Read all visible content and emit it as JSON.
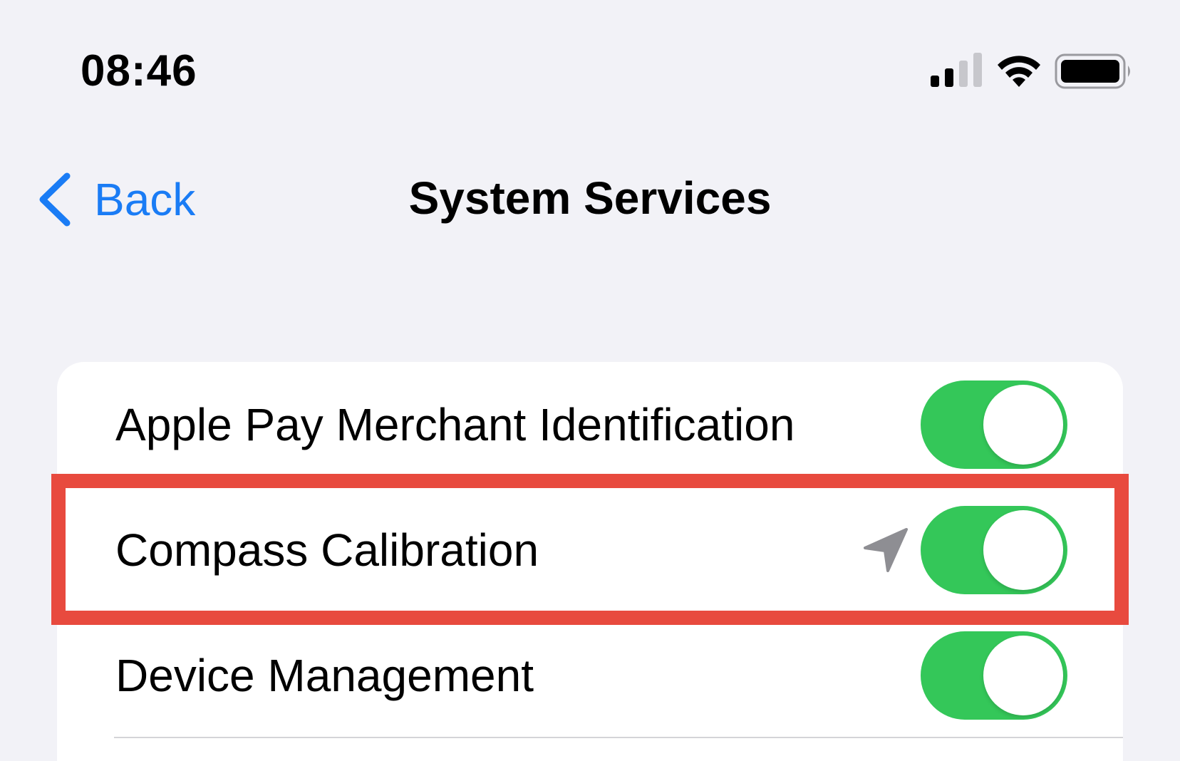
{
  "status_bar": {
    "time": "08:46",
    "icons": [
      "cellular-signal-icon",
      "wifi-icon",
      "battery-icon"
    ]
  },
  "nav": {
    "back_label": "Back",
    "title": "System Services"
  },
  "settings": {
    "rows": [
      {
        "label": "Apple Pay Merchant Identification",
        "enabled": true
      },
      {
        "label": "Compass Calibration",
        "enabled": true,
        "icon": "location-arrow-icon"
      },
      {
        "label": "Device Management",
        "enabled": true
      }
    ]
  },
  "colors": {
    "accent_blue": "#1a7cf5",
    "toggle_on": "#34c759",
    "highlight_red": "#e84a3e",
    "background": "#f2f2f7",
    "location_icon_gray": "#8e8e93"
  }
}
